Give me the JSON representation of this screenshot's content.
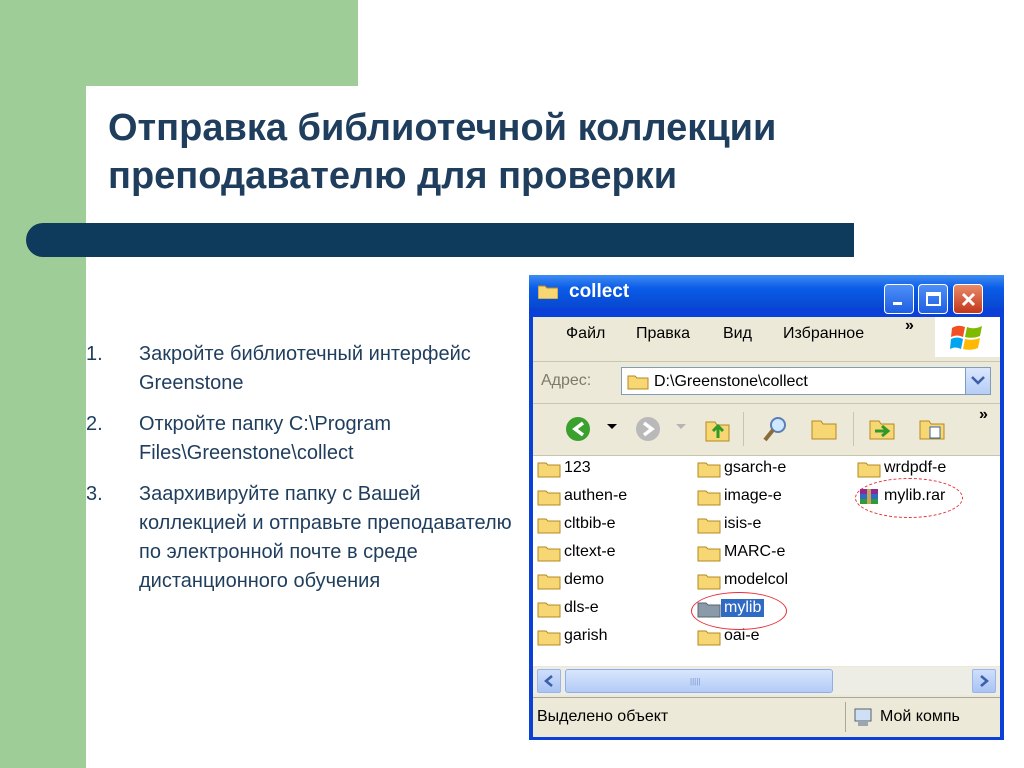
{
  "slide": {
    "title_line1": "Отправка библиотечной коллекции",
    "title_line2": "преподавателю для проверки",
    "steps": [
      {
        "num": "1.",
        "text": "Закройте библиотечный интерфейс Greenstone"
      },
      {
        "num": "2.",
        "text": "Откройте папку C:\\Program Files\\Greenstone\\collect"
      },
      {
        "num": "3.",
        "text": "Заархивируйте папку с Вашей коллекцией и отправьте преподавателю по электронной почте в среде дистанционного обучения"
      }
    ]
  },
  "explorer": {
    "title": "collect",
    "menu": [
      "Файл",
      "Правка",
      "Вид",
      "Избранное"
    ],
    "menu_more": "»",
    "address_label": "Адрес:",
    "address_value": "D:\\Greenstone\\collect",
    "toolbar_more": "»",
    "files": [
      {
        "name": "123",
        "type": "folder"
      },
      {
        "name": "authen-e",
        "type": "folder"
      },
      {
        "name": "cltbib-e",
        "type": "folder"
      },
      {
        "name": "cltext-e",
        "type": "folder"
      },
      {
        "name": "demo",
        "type": "folder"
      },
      {
        "name": "dls-e",
        "type": "folder"
      },
      {
        "name": "garish",
        "type": "folder"
      },
      {
        "name": "gsarch-e",
        "type": "folder"
      },
      {
        "name": "image-e",
        "type": "folder"
      },
      {
        "name": "isis-e",
        "type": "folder"
      },
      {
        "name": "MARC-e",
        "type": "folder"
      },
      {
        "name": "modelcol",
        "type": "folder"
      },
      {
        "name": "mylib",
        "type": "folder",
        "selected": true
      },
      {
        "name": "oai-e",
        "type": "folder"
      },
      {
        "name": "wrdpdf-e",
        "type": "folder"
      },
      {
        "name": "mylib.rar",
        "type": "rar-archive"
      }
    ],
    "status_left": "Выделено объект",
    "status_right": "Мой компь"
  },
  "colors": {
    "green": "#9fcd98",
    "navy_bar": "#0e3a5c",
    "title_text": "#1f3d5c",
    "xp_blue": "#0a3fd8",
    "highlight_oval": "#e8303a"
  }
}
